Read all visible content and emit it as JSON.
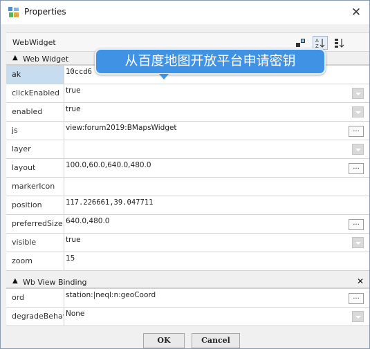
{
  "window": {
    "title": "Properties"
  },
  "header": {
    "component_name": "WebWidget",
    "icons": [
      "properties-icon",
      "sort-alpha-icon",
      "sort-category-icon"
    ]
  },
  "sections": [
    {
      "title": "Web Widget",
      "rows": [
        {
          "label": "ak",
          "value": "10ccd6",
          "selected": true
        },
        {
          "label": "clickEnabled",
          "value": "true",
          "control": "dropdown"
        },
        {
          "label": "enabled",
          "value": "true",
          "control": "dropdown"
        },
        {
          "label": "js",
          "value": "view:forum2019:BMapsWidget",
          "control": "ellipsis"
        },
        {
          "label": "layer",
          "value": "",
          "control": "dropdown"
        },
        {
          "label": "layout",
          "value": "100.0,60.0,640.0,480.0",
          "control": "ellipsis"
        },
        {
          "label": "markerIcon",
          "value": ""
        },
        {
          "label": "position",
          "value": "117.226661,39.047711"
        },
        {
          "label": "preferredSize",
          "value": "640.0,480.0",
          "control": "ellipsis"
        },
        {
          "label": "visible",
          "value": "true",
          "control": "dropdown"
        },
        {
          "label": "zoom",
          "value": "15"
        }
      ]
    },
    {
      "title": "Wb View Binding",
      "rows": [
        {
          "label": "ord",
          "value": "station:|neql:n:geoCoord",
          "control": "ellipsis"
        },
        {
          "label": "degradeBehav",
          "value": "None",
          "control": "dropdown"
        }
      ]
    }
  ],
  "buttons": {
    "ok": "OK",
    "cancel": "Cancel"
  },
  "ellipsis_label": "...",
  "callout": {
    "text": "从百度地图开放平台申请密钥"
  },
  "colors": {
    "accent": "#3f92e4",
    "selection": "#c8dcf0"
  }
}
